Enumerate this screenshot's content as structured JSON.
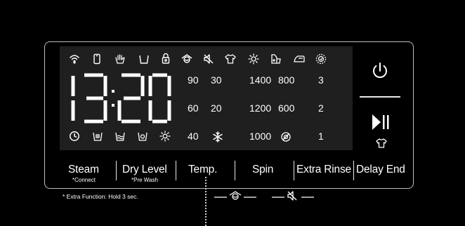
{
  "status_icons": [
    "wifi-icon",
    "phone-icon",
    "hand-wash-icon",
    "tub-icon",
    "lock-icon",
    "wash-icon",
    "mute-icon",
    "shirt-icon",
    "bright-icon",
    "dispenser-icon",
    "iron-icon",
    "drum-clean-icon"
  ],
  "time_display": {
    "hours": "13",
    "minutes": "20"
  },
  "temperature": {
    "values": [
      "90",
      "30",
      "60",
      "20",
      "40"
    ],
    "cold_icon": "snowflake-icon"
  },
  "spin": {
    "values": [
      "1400",
      "800",
      "1200",
      "600",
      "1000"
    ],
    "no_spin_icon": "no-spin-icon"
  },
  "rinse": {
    "values": [
      "3",
      "2",
      "1"
    ]
  },
  "bottom_icons": [
    "clock-icon",
    "tub-icon",
    "basin-icon",
    "bowl-icon",
    "sun-icon"
  ],
  "buttons": {
    "steam": "Steam",
    "steam_sub": "*Connect",
    "dry_level": "Dry Level",
    "dry_level_sub": "*Pre Wash",
    "temp": "Temp.",
    "spin": "Spin",
    "extra_rinse": "Extra Rinse",
    "delay_end": "Delay End"
  },
  "extra_note": "* Extra Function: Hold 3 sec.",
  "side": {
    "power_icon": "power-icon",
    "start_pause_icon": "play-pause-icon",
    "shirt_icon": "shirt-icon"
  },
  "colors": {
    "background": "#000000",
    "display": "#1f1f1f",
    "foreground": "#ffffff",
    "border": "#bdbdbd"
  }
}
